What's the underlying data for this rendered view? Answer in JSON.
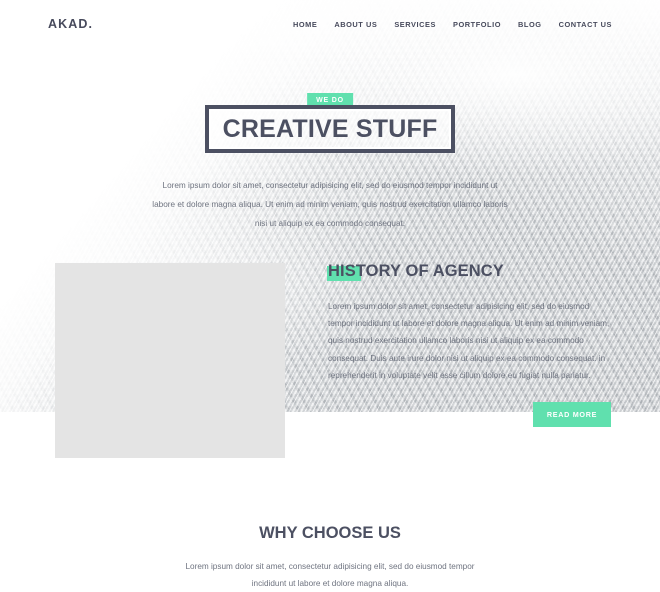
{
  "header": {
    "logo": "AKAD.",
    "nav": [
      {
        "label": "HOME"
      },
      {
        "label": "ABOUT US"
      },
      {
        "label": "SERVICES"
      },
      {
        "label": "PORTFOLIO"
      },
      {
        "label": "BLOG"
      },
      {
        "label": "CONTACT US"
      }
    ]
  },
  "hero": {
    "badge": "WE DO",
    "title": "CREATIVE STUFF",
    "paragraph": "Lorem ipsum dolor sit amet, consectetur adipisicing elit, sed do eiusmod tempor incididunt ut labore et dolore magna aliqua. Ut enim ad minim veniam, quis nostrud exercitation ullamco laboris nisi ut aliquip ex ea commodo consequat."
  },
  "history": {
    "title": "HISTORY OF AGENCY",
    "paragraph": "Lorem ipsum dolor sit amet, consectetur adipisicing elit, sed do eiusmod tempor incididunt ut labore et dolore magna aliqua. Ut enim ad minim veniam, quis nostrud exercitation ullamco laboris nisi ut aliquip ex ea commodo consequat. Duis aute irure dolor nisi ut aliquip ex ea commodo consequat. in reprehenderit in voluptate velit esse cillum dolore eu fugiat nulla pariatur.",
    "read_more": "READ MORE"
  },
  "why": {
    "title": "WHY CHOOSE US",
    "paragraph": "Lorem ipsum dolor sit amet, consectetur adipisicing elit, sed do eiusmod tempor incididunt ut labore et dolore magna aliqua."
  },
  "colors": {
    "accent_green": "#60e0ae",
    "dark_navy": "#4c5062",
    "body_text": "#6f7480",
    "placeholder_gray": "#e4e4e4"
  }
}
